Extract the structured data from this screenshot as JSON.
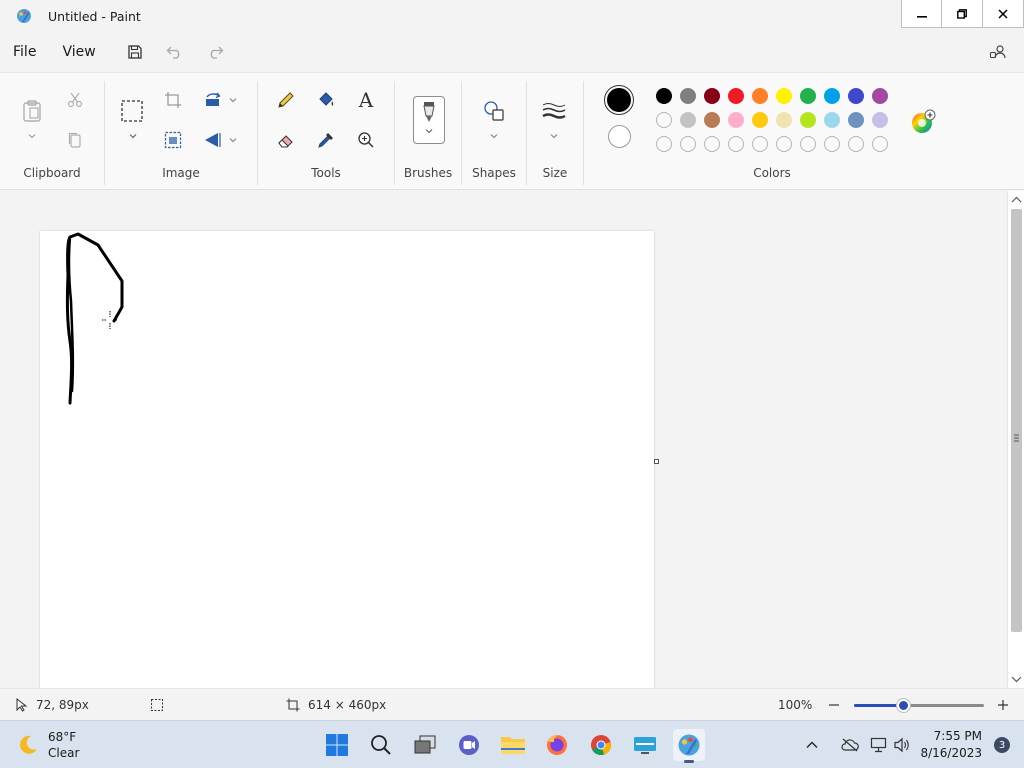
{
  "window": {
    "title": "Untitled - Paint"
  },
  "menu": {
    "file": "File",
    "view": "View"
  },
  "ribbon": {
    "groups": {
      "clipboard": "Clipboard",
      "image": "Image",
      "tools": "Tools",
      "brushes": "Brushes",
      "shapes": "Shapes",
      "size": "Size",
      "colors": "Colors"
    },
    "text_tool_glyph": "A"
  },
  "colors": {
    "primary": "#000000",
    "secondary": "#ffffff",
    "palette_row1": [
      "#000000",
      "#7f7f7f",
      "#880015",
      "#ed1c24",
      "#ff7f27",
      "#fff200",
      "#22b14c",
      "#00a2e8",
      "#3f48cc",
      "#a349a4"
    ],
    "palette_row2": [
      "#ffffff",
      "#c3c3c3",
      "#b97a57",
      "#ffaec9",
      "#ffc90e",
      "#efe4b0",
      "#b5e61d",
      "#99d9ea",
      "#7092be",
      "#c8bfe7"
    ],
    "palette_row3": [
      "",
      "",
      "",
      "",
      "",
      "",
      "",
      "",
      "",
      ""
    ]
  },
  "status": {
    "cursor_pos": "72, 89px",
    "canvas_size": "614 × 460px",
    "zoom": "100%",
    "zoom_level": 0.38
  },
  "taskbar": {
    "weather_temp": "68°F",
    "weather_desc": "Clear",
    "time": "7:55 PM",
    "date": "8/16/2023",
    "notifications": "3"
  }
}
